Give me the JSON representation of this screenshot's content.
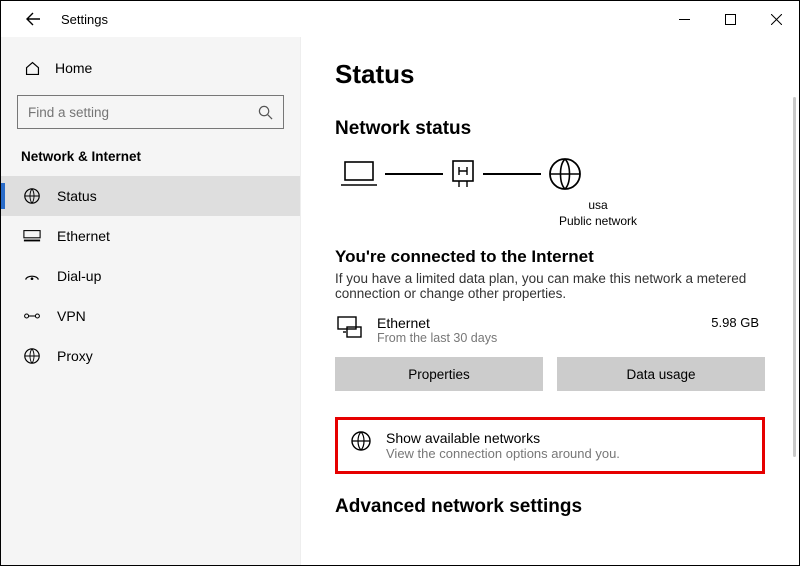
{
  "window": {
    "title": "Settings"
  },
  "sidebar": {
    "home_label": "Home",
    "search_placeholder": "Find a setting",
    "category": "Network & Internet",
    "items": [
      {
        "label": "Status"
      },
      {
        "label": "Ethernet"
      },
      {
        "label": "Dial-up"
      },
      {
        "label": "VPN"
      },
      {
        "label": "Proxy"
      }
    ]
  },
  "content": {
    "page_title": "Status",
    "section_title": "Network status",
    "diagram": {
      "name": "usa",
      "type": "Public network"
    },
    "connected_heading": "You're connected to the Internet",
    "connected_body": "If you have a limited data plan, you can make this network a metered connection or change other properties.",
    "adapter": {
      "name": "Ethernet",
      "sub": "From the last 30 days",
      "usage": "5.98 GB"
    },
    "buttons": {
      "properties": "Properties",
      "data_usage": "Data usage"
    },
    "show_networks": {
      "title": "Show available networks",
      "sub": "View the connection options around you."
    },
    "advanced_heading": "Advanced network settings"
  }
}
